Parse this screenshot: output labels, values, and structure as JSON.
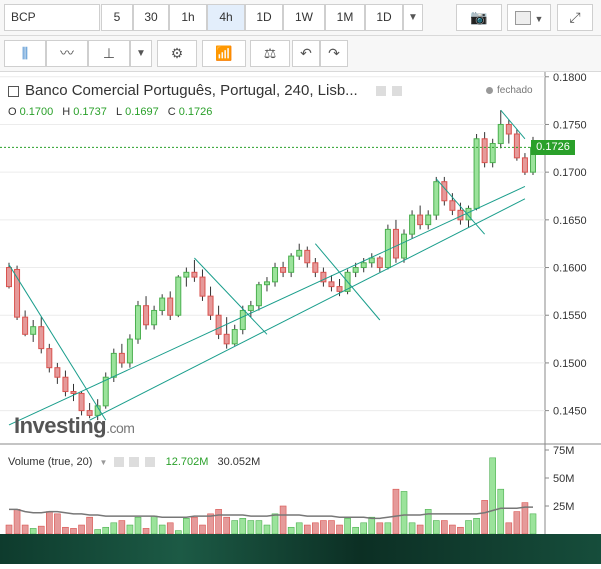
{
  "toolbar": {
    "symbol": "BCP",
    "intervals": [
      "5",
      "30",
      "1h",
      "4h",
      "1D",
      "1W",
      "1M",
      "1D"
    ],
    "active_interval": "4h"
  },
  "header": {
    "title": "Banco Comercial Português, Portugal, 240, Lisb...",
    "status": "fechado",
    "ohlc": {
      "o_label": "O",
      "o": "0.1700",
      "h_label": "H",
      "h": "0.1737",
      "l_label": "L",
      "l": "0.1697",
      "c_label": "C",
      "c": "0.1726"
    },
    "last_price": "0.1726"
  },
  "volume_legend": {
    "label": "Volume (true, 20)",
    "v1": "12.702M",
    "v2": "30.052M"
  },
  "logo": {
    "main": "Investing",
    "suffix": ".com"
  },
  "colors": {
    "up": "#4caf50",
    "down": "#d9534f",
    "upFill": "#9be39b",
    "downFill": "#e59a9a",
    "line": "#1a9e8c",
    "accent": "#2aa02a"
  },
  "chart_data": [
    {
      "type": "candlestick",
      "y_ticks": [
        "0.1800",
        "0.1750",
        "0.1700",
        "0.1650",
        "0.1600",
        "0.1550",
        "0.1500",
        "0.1450"
      ],
      "ylim": [
        0.1415,
        0.1805
      ],
      "candles": [
        [
          0.16,
          0.1605,
          0.1578,
          0.158
        ],
        [
          0.1598,
          0.1602,
          0.1545,
          0.1548
        ],
        [
          0.1548,
          0.1555,
          0.1528,
          0.153
        ],
        [
          0.153,
          0.1545,
          0.1522,
          0.1538
        ],
        [
          0.1538,
          0.1548,
          0.151,
          0.1515
        ],
        [
          0.1515,
          0.152,
          0.149,
          0.1495
        ],
        [
          0.1495,
          0.15,
          0.1478,
          0.1485
        ],
        [
          0.1485,
          0.1492,
          0.1465,
          0.147
        ],
        [
          0.147,
          0.1478,
          0.146,
          0.1468
        ],
        [
          0.1468,
          0.147,
          0.1445,
          0.145
        ],
        [
          0.145,
          0.1458,
          0.1442,
          0.1445
        ],
        [
          0.1445,
          0.1462,
          0.144,
          0.1455
        ],
        [
          0.1455,
          0.149,
          0.1452,
          0.1485
        ],
        [
          0.1485,
          0.1515,
          0.148,
          0.151
        ],
        [
          0.151,
          0.152,
          0.1495,
          0.15
        ],
        [
          0.15,
          0.153,
          0.1495,
          0.1525
        ],
        [
          0.1525,
          0.1565,
          0.152,
          0.156
        ],
        [
          0.156,
          0.157,
          0.1535,
          0.154
        ],
        [
          0.154,
          0.156,
          0.1535,
          0.1555
        ],
        [
          0.1555,
          0.1572,
          0.155,
          0.1568
        ],
        [
          0.1568,
          0.1575,
          0.1545,
          0.155
        ],
        [
          0.155,
          0.1592,
          0.1548,
          0.159
        ],
        [
          0.159,
          0.16,
          0.158,
          0.1595
        ],
        [
          0.1595,
          0.1608,
          0.1585,
          0.159
        ],
        [
          0.159,
          0.1598,
          0.1565,
          0.157
        ],
        [
          0.157,
          0.158,
          0.1545,
          0.155
        ],
        [
          0.155,
          0.156,
          0.1525,
          0.153
        ],
        [
          0.153,
          0.1548,
          0.1515,
          0.152
        ],
        [
          0.152,
          0.154,
          0.1518,
          0.1535
        ],
        [
          0.1535,
          0.156,
          0.153,
          0.1555
        ],
        [
          0.1555,
          0.1565,
          0.1548,
          0.156
        ],
        [
          0.156,
          0.1585,
          0.1555,
          0.1582
        ],
        [
          0.1582,
          0.159,
          0.1575,
          0.1585
        ],
        [
          0.1585,
          0.1605,
          0.158,
          0.16
        ],
        [
          0.16,
          0.1606,
          0.159,
          0.1595
        ],
        [
          0.1595,
          0.1615,
          0.159,
          0.1612
        ],
        [
          0.1612,
          0.1625,
          0.1608,
          0.1618
        ],
        [
          0.1618,
          0.1622,
          0.16,
          0.1605
        ],
        [
          0.1605,
          0.161,
          0.159,
          0.1595
        ],
        [
          0.1595,
          0.16,
          0.158,
          0.1585
        ],
        [
          0.1585,
          0.1592,
          0.1575,
          0.158
        ],
        [
          0.158,
          0.1588,
          0.157,
          0.1575
        ],
        [
          0.1575,
          0.1598,
          0.1572,
          0.1595
        ],
        [
          0.1595,
          0.1605,
          0.159,
          0.16
        ],
        [
          0.16,
          0.161,
          0.1595,
          0.1605
        ],
        [
          0.1605,
          0.1615,
          0.16,
          0.161
        ],
        [
          0.161,
          0.1612,
          0.1595,
          0.16
        ],
        [
          0.16,
          0.1645,
          0.1598,
          0.164
        ],
        [
          0.164,
          0.165,
          0.1605,
          0.161
        ],
        [
          0.161,
          0.164,
          0.1605,
          0.1635
        ],
        [
          0.1635,
          0.166,
          0.163,
          0.1655
        ],
        [
          0.1655,
          0.1665,
          0.164,
          0.1645
        ],
        [
          0.1645,
          0.166,
          0.164,
          0.1655
        ],
        [
          0.1655,
          0.1695,
          0.165,
          0.169
        ],
        [
          0.169,
          0.1695,
          0.1665,
          0.167
        ],
        [
          0.167,
          0.1678,
          0.1655,
          0.166
        ],
        [
          0.166,
          0.1668,
          0.1645,
          0.165
        ],
        [
          0.165,
          0.1665,
          0.1642,
          0.1662
        ],
        [
          0.1662,
          0.174,
          0.166,
          0.1735
        ],
        [
          0.1735,
          0.1742,
          0.1705,
          0.171
        ],
        [
          0.171,
          0.1735,
          0.1705,
          0.173
        ],
        [
          0.173,
          0.1765,
          0.1725,
          0.175
        ],
        [
          0.175,
          0.1755,
          0.173,
          0.174
        ],
        [
          0.174,
          0.1745,
          0.1712,
          0.1715
        ],
        [
          0.1715,
          0.172,
          0.1697,
          0.17
        ],
        [
          0.17,
          0.1737,
          0.1697,
          0.1726
        ]
      ],
      "trendlines": [
        [
          [
            0,
            0.1603
          ],
          [
            12,
            0.144
          ]
        ],
        [
          [
            0,
            0.1435
          ],
          [
            64,
            0.1685
          ]
        ],
        [
          [
            10,
            0.144
          ],
          [
            64,
            0.1672
          ]
        ],
        [
          [
            23,
            0.161
          ],
          [
            32,
            0.153
          ]
        ],
        [
          [
            38,
            0.1625
          ],
          [
            46,
            0.1545
          ]
        ],
        [
          [
            53,
            0.1693
          ],
          [
            59,
            0.1635
          ]
        ],
        [
          [
            61,
            0.1765
          ],
          [
            64,
            0.1735
          ]
        ]
      ],
      "current_price": 0.1726
    },
    {
      "type": "bar",
      "title": "Volume (true, 20)",
      "y_ticks": [
        "75M",
        "50M",
        "25M"
      ],
      "ylim": [
        0,
        75
      ],
      "values": [
        8,
        22,
        8,
        5,
        7,
        20,
        18,
        6,
        5,
        8,
        15,
        4,
        6,
        10,
        12,
        8,
        15,
        5,
        16,
        8,
        10,
        3,
        14,
        15,
        8,
        18,
        22,
        15,
        12,
        14,
        12,
        12,
        8,
        18,
        25,
        6,
        10,
        8,
        10,
        12,
        12,
        8,
        14,
        6,
        10,
        15,
        10,
        10,
        40,
        38,
        10,
        8,
        22,
        12,
        12,
        8,
        6,
        12,
        14,
        30,
        68,
        40,
        10,
        20,
        28,
        18
      ],
      "ma_values": [
        22,
        22,
        20,
        19,
        19,
        20,
        20,
        19,
        18,
        18,
        17,
        17,
        16,
        16,
        16,
        16,
        16,
        16,
        16,
        15,
        15,
        15,
        15,
        16,
        16,
        16,
        17,
        17,
        17,
        17,
        16,
        16,
        16,
        17,
        17,
        17,
        17,
        16,
        16,
        16,
        16,
        15,
        15,
        15,
        15,
        14,
        14,
        15,
        16,
        17,
        17,
        17,
        18,
        18,
        18,
        18,
        18,
        18,
        18,
        19,
        21,
        23,
        23,
        23,
        24,
        24
      ]
    }
  ]
}
